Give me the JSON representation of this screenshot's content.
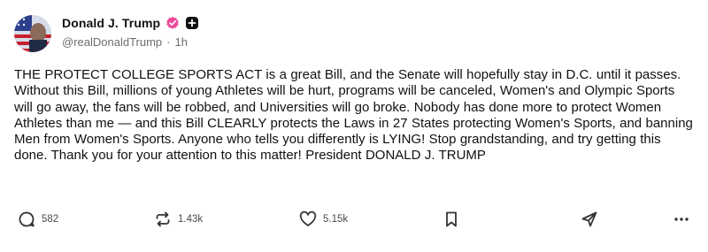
{
  "author": {
    "name": "Donald J. Trump",
    "handle": "@realDonaldTrump",
    "separator": "·",
    "time_ago": "1h"
  },
  "post": {
    "text": "THE PROTECT COLLEGE SPORTS ACT is a great Bill, and the Senate will hopefully stay in D.C. until it passes. Without this Bill, millions of young Athletes will be hurt, programs will be canceled, Women's and Olympic Sports will go away, the fans will be robbed, and Universities will go broke. Nobody has done more to protect Women Athletes than me — and this Bill CLEARLY protects the Laws in 27 States protecting Women's Sports, and banning Men from Women's Sports. Anyone who tells you differently is LYING! Stop grandstanding, and try getting this done. Thank you for your attention to this matter! President DONALD J. TRUMP"
  },
  "actions": {
    "replies": "582",
    "reposts": "1.43k",
    "likes": "5.15k"
  },
  "icons": {
    "verified": "verified-badge-icon",
    "plus": "plus-square-icon",
    "reply": "comment-icon",
    "repost": "repost-icon",
    "like": "heart-icon",
    "save": "bookmark-icon",
    "share": "share-icon",
    "more": "more-horizontal-icon"
  },
  "colors": {
    "verified_badge": "#ec4899",
    "text": "#111111",
    "muted": "#6e6e6e"
  }
}
